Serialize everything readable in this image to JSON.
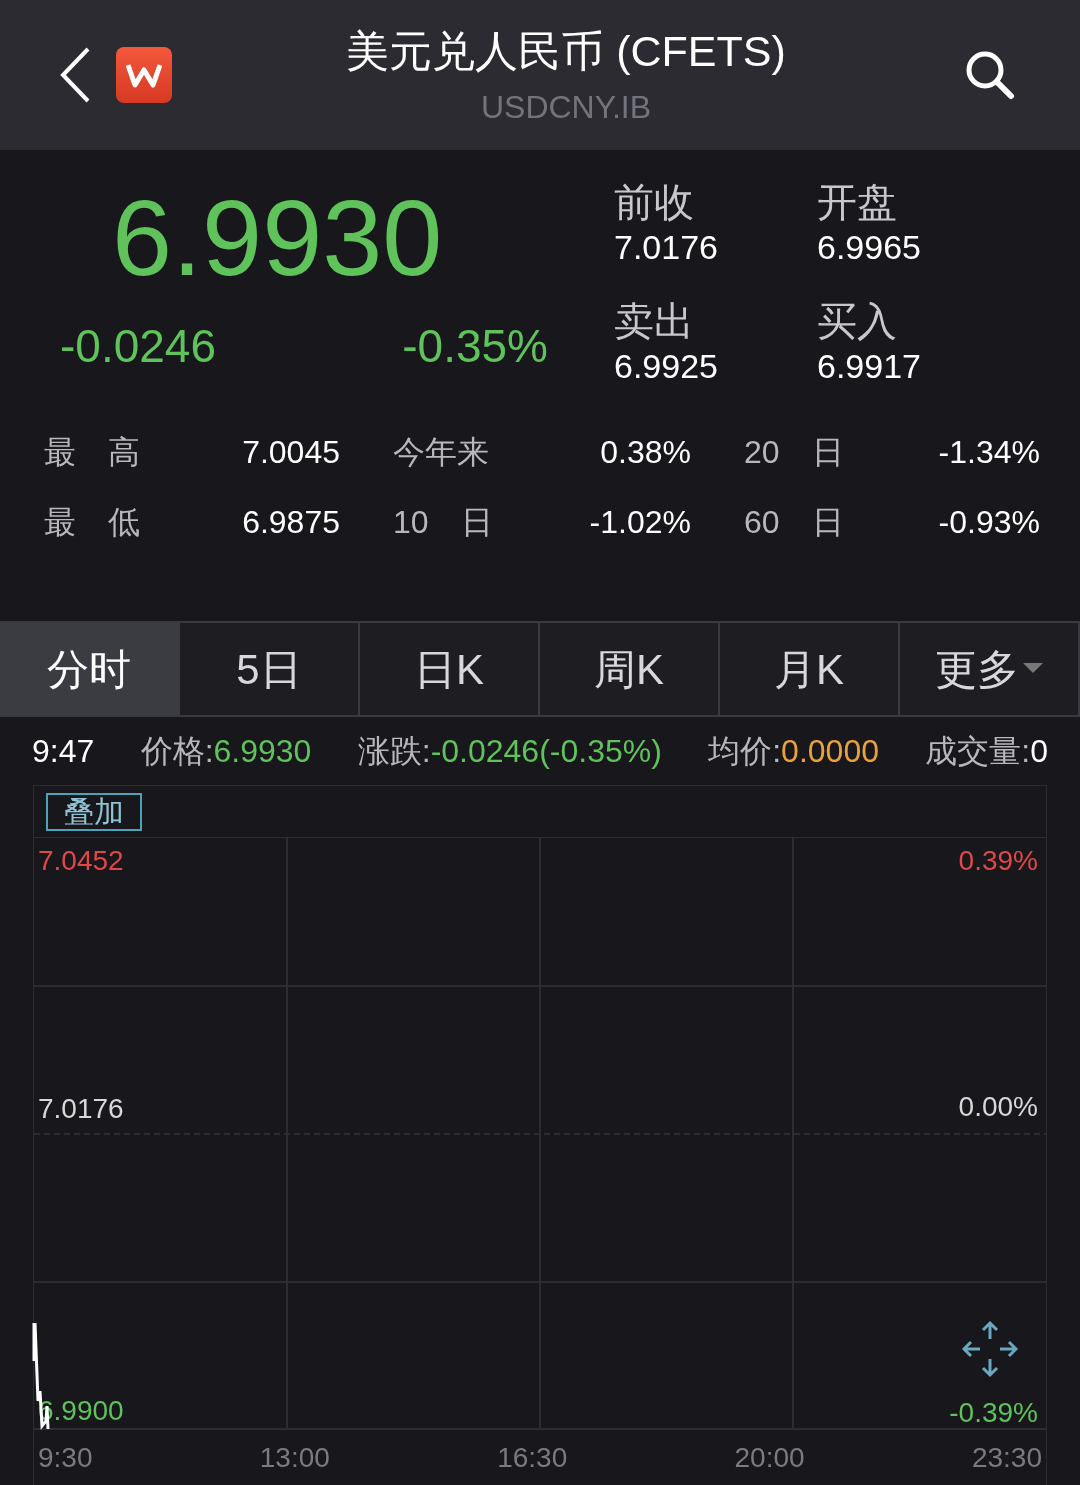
{
  "header": {
    "title": "美元兑人民币 (CFETS)",
    "code": "USDCNY.IB"
  },
  "quote": {
    "price": "6.9930",
    "change": "-0.0246",
    "change_pct": "-0.35%"
  },
  "quote_fields": [
    {
      "label": "前收",
      "value": "7.0176"
    },
    {
      "label": "开盘",
      "value": "6.9965"
    },
    {
      "label": "卖出",
      "value": "6.9925"
    },
    {
      "label": "买入",
      "value": "6.9917"
    }
  ],
  "stats": [
    [
      {
        "label": "最　高",
        "value": "7.0045"
      },
      {
        "label": "今年来",
        "value": "0.38%"
      },
      {
        "label": "20　日",
        "value": "-1.34%"
      }
    ],
    [
      {
        "label": "最　低",
        "value": "6.9875"
      },
      {
        "label": "10　日",
        "value": "-1.02%"
      },
      {
        "label": "60　日",
        "value": "-0.93%"
      }
    ]
  ],
  "tabs": [
    {
      "label": "分时",
      "selected": true,
      "dropdown": false
    },
    {
      "label": "5日",
      "selected": false,
      "dropdown": false
    },
    {
      "label": "日K",
      "selected": false,
      "dropdown": false
    },
    {
      "label": "周K",
      "selected": false,
      "dropdown": false
    },
    {
      "label": "月K",
      "selected": false,
      "dropdown": false
    },
    {
      "label": "更多",
      "selected": false,
      "dropdown": true
    }
  ],
  "info_bar": {
    "time": "9:47",
    "items": [
      {
        "label": "价格:",
        "value": "6.9930",
        "color": "#5fc25a"
      },
      {
        "label": "涨跌:",
        "value": "-0.0246(-0.35%)",
        "color": "#5fc25a"
      },
      {
        "label": "均价:",
        "value": "0.0000",
        "color": "#e9a23b"
      },
      {
        "label": "成交量:",
        "value": "0",
        "color": "#ffffff"
      }
    ]
  },
  "chart": {
    "overlay_button": "叠加",
    "price_labels": [
      {
        "text": "7.0452",
        "color": "#e04848"
      },
      {
        "text": "7.0176",
        "color": "#d8d8d8"
      },
      {
        "text": "6.9900",
        "color": "#5fc25a"
      }
    ],
    "pct_labels": [
      {
        "text": "0.39%",
        "color": "#e04848"
      },
      {
        "text": "0.00%",
        "color": "#d8d8d8"
      },
      {
        "text": "-0.39%",
        "color": "#5fc25a"
      }
    ],
    "time_labels": [
      "9:30",
      "13:00",
      "16:30",
      "20:00",
      "23:30"
    ]
  }
}
